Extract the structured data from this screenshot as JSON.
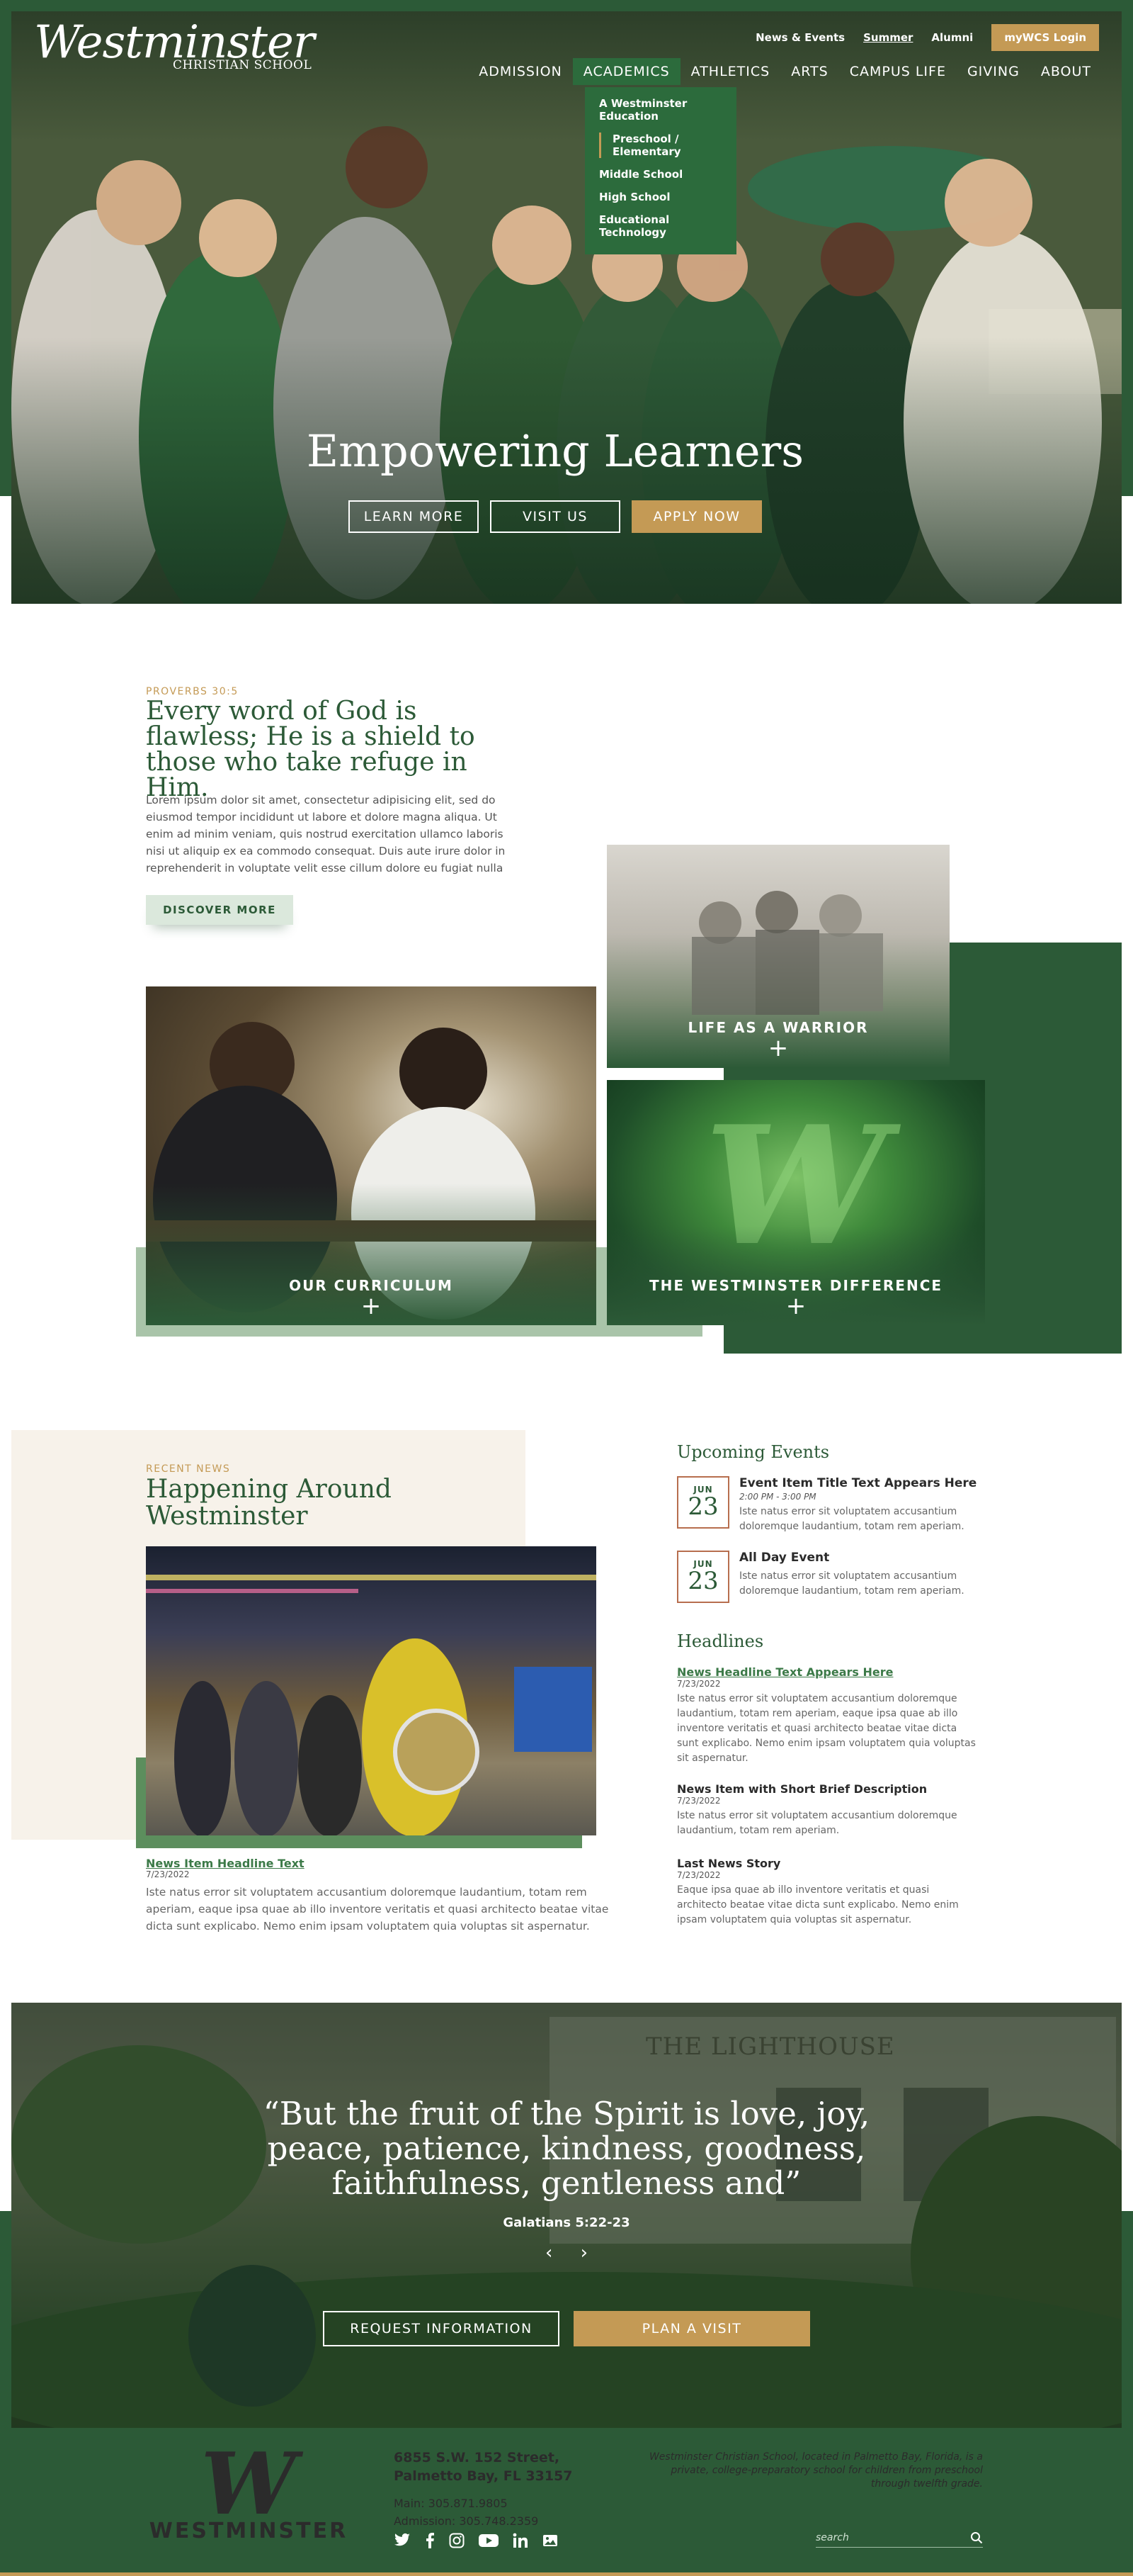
{
  "colors": {
    "brand_green": "#2c5a37",
    "accent_gold": "#c49a55",
    "light_green": "#a9c4a9"
  },
  "header": {
    "logo_text": "Westminster",
    "logo_sub": "CHRISTIAN SCHOOL",
    "utility": [
      "News & Events",
      "Summer",
      "Alumni"
    ],
    "mywcs": "myWCS Login",
    "nav": [
      "ADMISSION",
      "ACADEMICS",
      "ATHLETICS",
      "ARTS",
      "CAMPUS LIFE",
      "GIVING",
      "ABOUT"
    ],
    "dropdown": [
      "A Westminster Education",
      "Preschool / Elementary",
      "Middle School",
      "High School",
      "Educational Technology"
    ]
  },
  "hero": {
    "title": "Empowering Learners",
    "buttons": [
      "LEARN MORE",
      "VISIT US",
      "APPLY NOW"
    ]
  },
  "verse": {
    "kicker": "PROVERBS 30:5",
    "title": "Every word of God is flawless; He is a shield to those who take refuge in Him.",
    "body": "Lorem ipsum dolor sit amet, consectetur adipisicing elit, sed do eiusmod tempor incididunt ut labore et dolore magna aliqua. Ut enim ad minim veniam, quis nostrud exercitation ullamco laboris nisi ut aliquip ex ea commodo consequat. Duis aute irure dolor in reprehenderit in voluptate velit esse cillum dolore eu fugiat nulla",
    "button": "DISCOVER MORE"
  },
  "tiles": {
    "life": "LIFE AS A WARRIOR",
    "curriculum": "OUR CURRICULUM",
    "difference": "THE WESTMINSTER DIFFERENCE",
    "plus": "+"
  },
  "news": {
    "kicker": "RECENT NEWS",
    "title": "Happening Around Westminster",
    "item_title": "News Item Headline Text",
    "item_date": "7/23/2022",
    "item_body": "Iste natus error sit voluptatem accusantium doloremque laudantium, totam rem aperiam, eaque ipsa quae ab illo inventore veritatis et quasi architecto beatae vitae dicta sunt explicabo. Nemo enim ipsam voluptatem quia voluptas sit aspernatur."
  },
  "events": {
    "heading": "Upcoming Events",
    "items": [
      {
        "month": "JUN",
        "day": "23",
        "title": "Event Item Title Text Appears Here",
        "time": "2:00 PM - 3:00 PM",
        "body": "Iste natus error sit voluptatem accusantium doloremque laudantium, totam rem aperiam."
      },
      {
        "month": "JUN",
        "day": "23",
        "title": "All Day Event",
        "time": "",
        "body": "Iste natus error sit voluptatem accusantium doloremque laudantium, totam rem aperiam."
      }
    ]
  },
  "headlines": {
    "heading": "Headlines",
    "items": [
      {
        "title": "News Headline Text Appears Here",
        "date": "7/23/2022",
        "body": "Iste natus error sit voluptatem accusantium doloremque laudantium, totam rem aperiam, eaque ipsa quae ab illo inventore veritatis et quasi architecto beatae vitae dicta sunt explicabo. Nemo enim ipsam voluptatem quia voluptas sit aspernatur."
      },
      {
        "title": "News Item with Short Brief Description",
        "date": "7/23/2022",
        "body": "Iste natus error sit voluptatem accusantium doloremque laudantium, totam rem aperiam."
      },
      {
        "title": "Last News Story",
        "date": "7/23/2022",
        "body": "Eaque ipsa quae ab illo inventore veritatis et quasi architecto beatae vitae dicta sunt explicabo. Nemo enim ipsam voluptatem quia voluptas sit aspernatur."
      }
    ]
  },
  "quote": {
    "sign": "THE LIGHTHOUSE",
    "text": "“But the fruit of the Spirit is love, joy, peace, patience, kindness, goodness, faithfulness, gentleness and”",
    "ref": "Galatians 5:22-23",
    "prev": "‹",
    "next": "›",
    "buttons": [
      "REQUEST INFORMATION",
      "PLAN A VISIT"
    ]
  },
  "footer": {
    "logo_letter": "W",
    "logo_name": "WESTMINSTER",
    "address1": "6855 S.W. 152 Street,",
    "address2": "Palmetto Bay, FL 33157",
    "main": "Main: 305.871.9805",
    "admission": "Admission: 305.748.2359",
    "description": "Westminster Christian School, located in Palmetto Bay, Florida, is a private, college-preparatory school for children from preschool through twelfth grade.",
    "search_placeholder": "search",
    "social": [
      "twitter-icon",
      "facebook-icon",
      "instagram-icon",
      "youtube-icon",
      "linkedin-icon",
      "flickr-icon"
    ]
  }
}
